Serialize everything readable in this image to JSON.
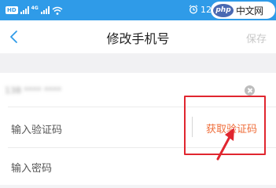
{
  "status_bar": {
    "hd_badge": "HD",
    "network_type": "4G",
    "time": "12"
  },
  "watermark": {
    "logo": "php",
    "text": "中文网"
  },
  "nav": {
    "title": "修改手机号",
    "save_label": "保存"
  },
  "form": {
    "phone_value": "138 **** ****",
    "code_placeholder": "输入验证码",
    "get_code_label": "获取验证码",
    "password_placeholder": "输入密码"
  },
  "colors": {
    "status_bar": "#2f9be8",
    "accent": "#ef6d3a",
    "highlight": "#e0262f"
  }
}
